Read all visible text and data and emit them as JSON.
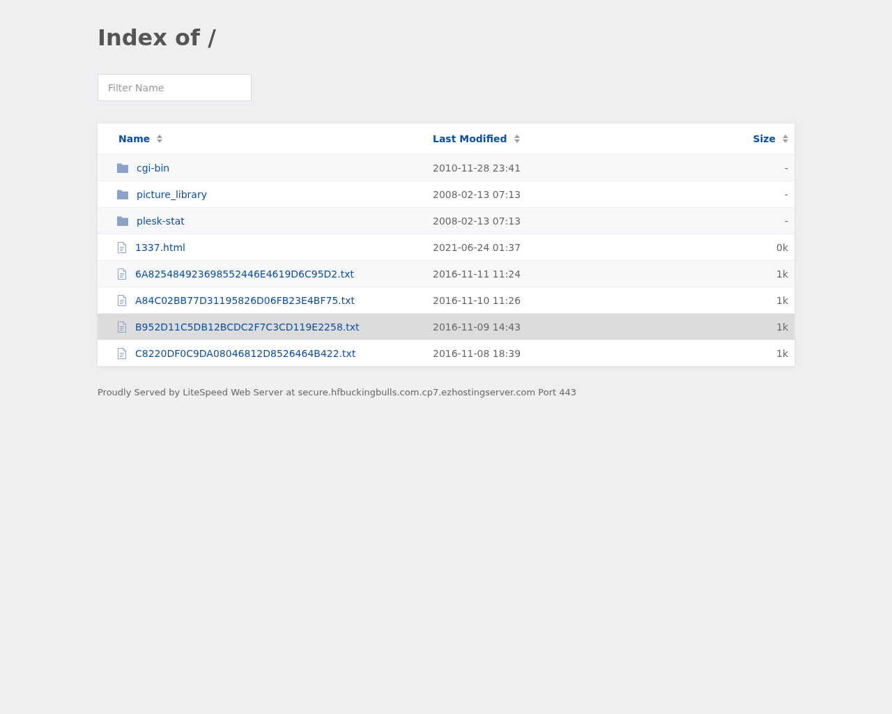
{
  "title": "Index of /",
  "filter": {
    "placeholder": "Filter Name"
  },
  "table": {
    "columns": [
      {
        "label": "Name"
      },
      {
        "label": "Last Modified"
      },
      {
        "label": "Size"
      }
    ],
    "rows": [
      {
        "kind": "folder",
        "name": "cgi-bin",
        "modified": "2010-11-28 23:41",
        "size": "-",
        "selected": false
      },
      {
        "kind": "folder",
        "name": "picture_library",
        "modified": "2008-02-13 07:13",
        "size": "-",
        "selected": false
      },
      {
        "kind": "folder",
        "name": "plesk-stat",
        "modified": "2008-02-13 07:13",
        "size": "-",
        "selected": false
      },
      {
        "kind": "file",
        "name": "1337.html",
        "modified": "2021-06-24 01:37",
        "size": "0k",
        "selected": false
      },
      {
        "kind": "file",
        "name": "6A825484923698552446E4619D6C95D2.txt",
        "modified": "2016-11-11 11:24",
        "size": "1k",
        "selected": false
      },
      {
        "kind": "file",
        "name": "A84C02BB77D31195826D06FB23E4BF75.txt",
        "modified": "2016-11-10 11:26",
        "size": "1k",
        "selected": false
      },
      {
        "kind": "file",
        "name": "B952D11C5DB12BCDC2F7C3CD119E2258.txt",
        "modified": "2016-11-09 14:43",
        "size": "1k",
        "selected": true
      },
      {
        "kind": "file",
        "name": "C8220DF0C9DA08046812D8526464B422.txt",
        "modified": "2016-11-08 18:39",
        "size": "1k",
        "selected": false
      }
    ]
  },
  "footer": "Proudly Served by LiteSpeed Web Server at secure.hfbuckingbulls.com.cp7.ezhostingserver.com Port 443"
}
